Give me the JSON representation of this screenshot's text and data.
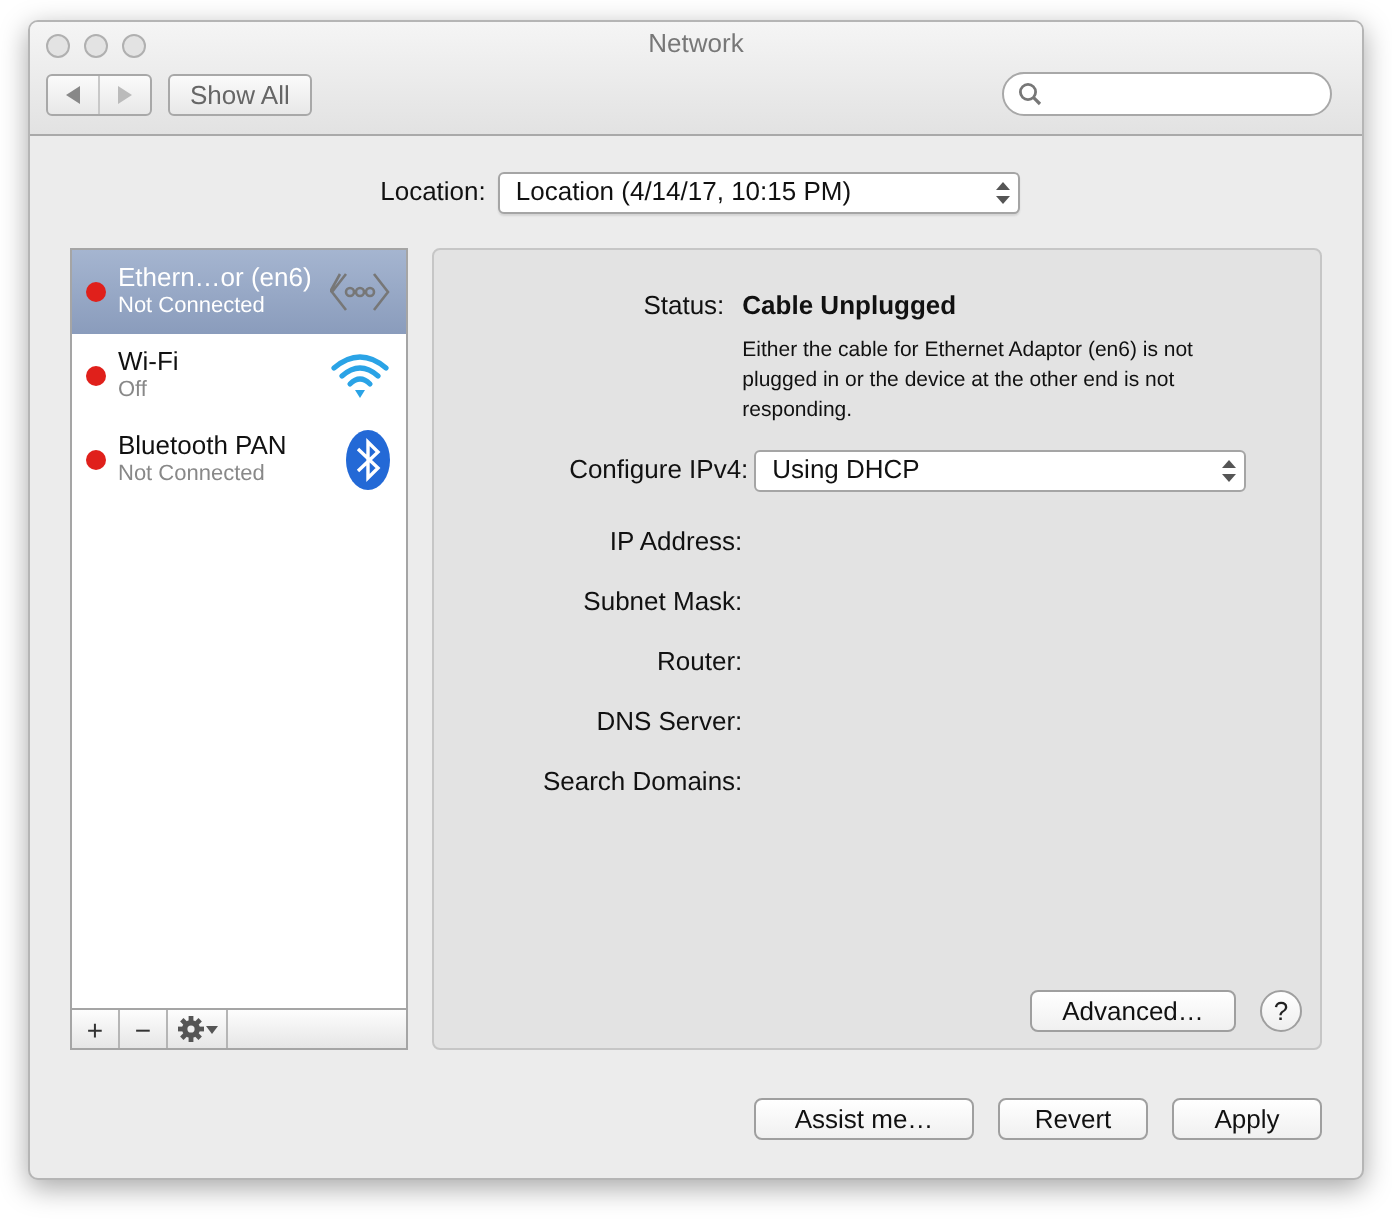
{
  "window": {
    "title": "Network"
  },
  "toolbar": {
    "show_all": "Show All"
  },
  "location": {
    "label": "Location:",
    "value": "Location (4/14/17, 10:15 PM)"
  },
  "services": [
    {
      "name": "Ethern…or (en6)",
      "status": "Not Connected",
      "kind": "ethernet",
      "color": "#e0201b",
      "selected": true
    },
    {
      "name": "Wi-Fi",
      "status": "Off",
      "kind": "wifi",
      "color": "#e0201b",
      "selected": false
    },
    {
      "name": "Bluetooth PAN",
      "status": "Not Connected",
      "kind": "bluetooth",
      "color": "#e0201b",
      "selected": false
    }
  ],
  "list_buttons": [
    "+",
    "−"
  ],
  "detail": {
    "status_label": "Status:",
    "status_value": "Cable Unplugged",
    "status_description": "Either the cable for Ethernet Adaptor (en6) is not plugged in or the device at the other end is not responding.",
    "configure": {
      "label": "Configure IPv4:",
      "value": "Using DHCP"
    },
    "fields": [
      {
        "label": "IP Address:"
      },
      {
        "label": "Subnet Mask:"
      },
      {
        "label": "Router:"
      },
      {
        "label": "DNS Server:"
      },
      {
        "label": "Search Domains:"
      }
    ],
    "advanced": "Advanced…",
    "help": "?"
  },
  "buttons": [
    "Assist me…",
    "Revert",
    "Apply"
  ]
}
